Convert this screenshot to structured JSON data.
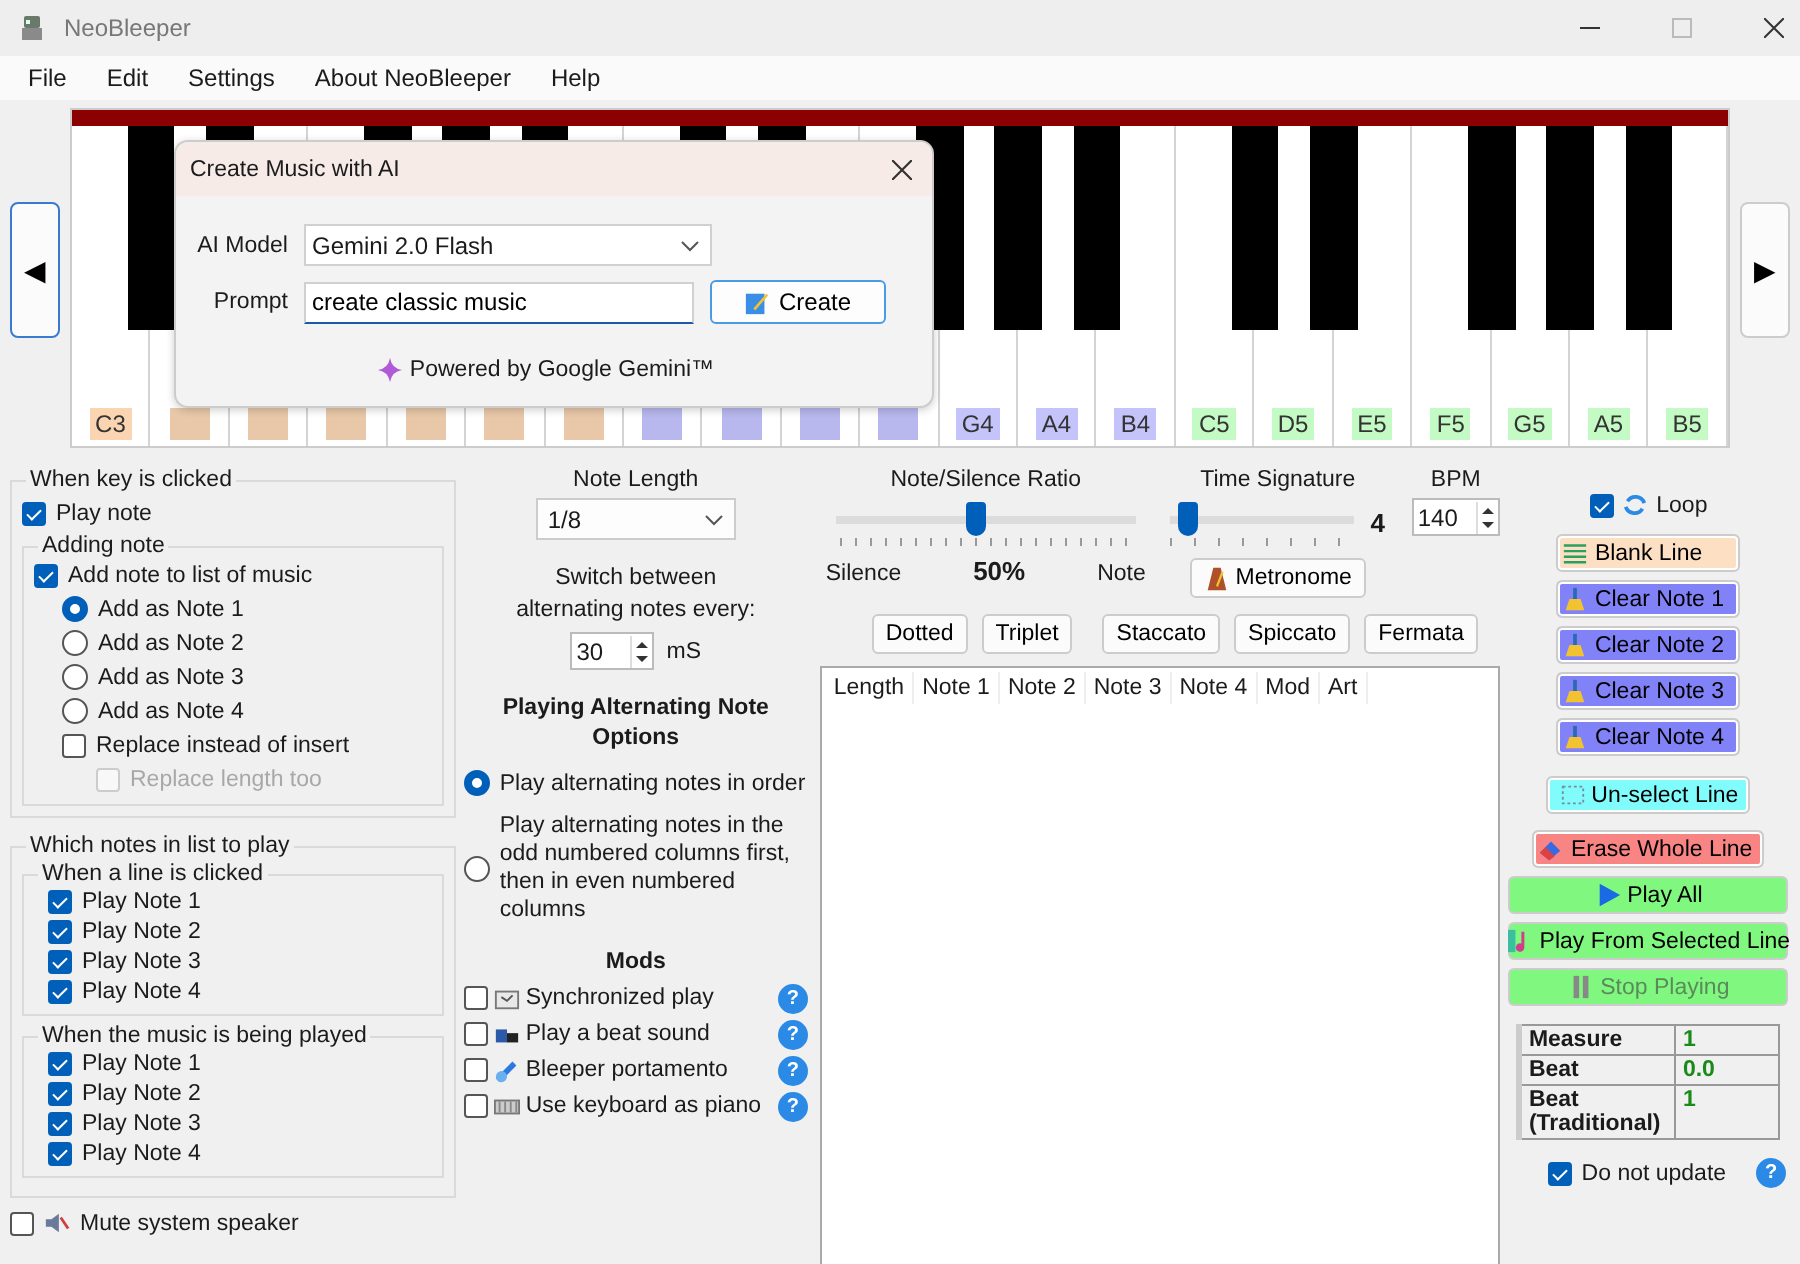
{
  "window": {
    "title": "NeoBleeper"
  },
  "menu": [
    "File",
    "Edit",
    "Settings",
    "About NeoBleeper",
    "Help"
  ],
  "keyboard": {
    "left": "◀",
    "right": "▶",
    "keys": [
      {
        "label": "C3",
        "color": "#fbd5b2",
        "sharp": true
      },
      {
        "color": "#e8c8a8",
        "sharp": true
      },
      {
        "color": "#e8c8a8",
        "sharp": false
      },
      {
        "color": "#e8c8a8",
        "sharp": true
      },
      {
        "color": "#e8c8a8",
        "sharp": true
      },
      {
        "color": "#e8c8a8",
        "sharp": true
      },
      {
        "color": "#e8c8a8",
        "sharp": false
      },
      {
        "color": "#b8b8ee",
        "sharp": true
      },
      {
        "color": "#b8b8ee",
        "sharp": true
      },
      {
        "color": "#b8b8ee",
        "sharp": false
      },
      {
        "color": "#b8b8ee",
        "sharp": true
      },
      {
        "label": "G4",
        "color": "#c4c4fa",
        "sharp": true
      },
      {
        "label": "A4",
        "color": "#c4c4fa",
        "sharp": true
      },
      {
        "label": "B4",
        "color": "#c4c4fa",
        "sharp": false
      },
      {
        "label": "C5",
        "color": "#c4fac4",
        "sharp": true
      },
      {
        "label": "D5",
        "color": "#c4fac4",
        "sharp": true
      },
      {
        "label": "E5",
        "color": "#c4fac4",
        "sharp": false
      },
      {
        "label": "F5",
        "color": "#c4fac4",
        "sharp": true
      },
      {
        "label": "G5",
        "color": "#c4fac4",
        "sharp": true
      },
      {
        "label": "A5",
        "color": "#c4fac4",
        "sharp": true
      },
      {
        "label": "B5",
        "color": "#c4fac4",
        "sharp": false
      }
    ]
  },
  "dialog": {
    "title": "Create Music with AI",
    "model_label": "AI Model",
    "model": "Gemini 2.0 Flash",
    "prompt_label": "Prompt",
    "prompt": "create classic music",
    "create_button": "Create",
    "footer": "Powered by Google Gemini™"
  },
  "key_clicked": {
    "title": "When key is clicked",
    "play_note": {
      "label": "Play note",
      "checked": true
    },
    "adding": {
      "title": "Adding note",
      "add_to_list": {
        "label": "Add note to list of music",
        "checked": true
      },
      "options": [
        {
          "label": "Add as Note 1",
          "selected": true
        },
        {
          "label": "Add as Note 2",
          "selected": false
        },
        {
          "label": "Add as Note 3",
          "selected": false
        },
        {
          "label": "Add as Note 4",
          "selected": false
        }
      ],
      "replace": {
        "label": "Replace instead of insert",
        "checked": false
      },
      "replace_length": {
        "label": "Replace length too",
        "checked": false,
        "disabled": true
      }
    }
  },
  "which_notes": {
    "title": "Which notes in list to play",
    "groups": [
      {
        "title": "When a line is clicked",
        "items": [
          {
            "label": "Play Note 1",
            "checked": true
          },
          {
            "label": "Play Note 2",
            "checked": true
          },
          {
            "label": "Play Note 3",
            "checked": true
          },
          {
            "label": "Play Note 4",
            "checked": true
          }
        ]
      },
      {
        "title": "When the music is being played",
        "items": [
          {
            "label": "Play Note 1",
            "checked": true
          },
          {
            "label": "Play Note 2",
            "checked": true
          },
          {
            "label": "Play Note 3",
            "checked": true
          },
          {
            "label": "Play Note 4",
            "checked": true
          }
        ]
      }
    ]
  },
  "mute": {
    "label": "Mute system speaker",
    "checked": false
  },
  "note_length": {
    "label": "Note Length",
    "value": "1/8"
  },
  "switch": {
    "label": "Switch between alternating notes every:",
    "value": "30",
    "unit": "mS"
  },
  "alternating": {
    "title": "Playing Alternating Note Options",
    "options": [
      {
        "label": "Play alternating notes in order",
        "selected": true
      },
      {
        "label": "Play alternating notes in the odd numbered columns first, then in even numbered columns",
        "selected": false
      }
    ]
  },
  "mods": {
    "title": "Mods",
    "items": [
      {
        "label": "Synchronized play",
        "checked": false,
        "kind": "sync",
        "help": "?"
      },
      {
        "label": "Play a beat sound",
        "checked": false,
        "kind": "beat",
        "help": "?"
      },
      {
        "label": "Bleeper portamento",
        "checked": false,
        "kind": "portamento",
        "help": "?"
      },
      {
        "label": "Use keyboard as piano",
        "checked": false,
        "kind": "keyboard",
        "help": "?"
      }
    ]
  },
  "ratio": {
    "title": "Note/Silence Ratio",
    "level": 0.47,
    "left": "Silence",
    "reading": "50%",
    "right": "Note"
  },
  "time_signature": {
    "title": "Time Signature",
    "level": 0.1,
    "value": "4",
    "metronome": "Metronome"
  },
  "bpm": {
    "label": "BPM",
    "value": "140"
  },
  "articulations": [
    "Dotted",
    "Triplet",
    "Staccato",
    "Spiccato",
    "Fermata"
  ],
  "table": {
    "columns": [
      "Length",
      "Note 1",
      "Note 2",
      "Note 3",
      "Note 4",
      "Mod",
      "Art"
    ]
  },
  "loop": {
    "label": "Loop",
    "checked": true
  },
  "line_buttons": [
    {
      "label": "Blank Line",
      "color": "#fde0c4",
      "kind": "lines"
    },
    {
      "label": "Clear Note 1",
      "color": "#8282f8",
      "kind": "broom"
    },
    {
      "label": "Clear Note 2",
      "color": "#8282f8",
      "kind": "broom"
    },
    {
      "label": "Clear Note 3",
      "color": "#8282f8",
      "kind": "broom"
    },
    {
      "label": "Clear Note 4",
      "color": "#8282f8",
      "kind": "broom"
    },
    {
      "label": "Un-select Line",
      "color": "#80fcfc",
      "kind": "select"
    },
    {
      "label": "Erase Whole Line",
      "color": "#f88484",
      "kind": "eraser"
    }
  ],
  "play_buttons": [
    {
      "label": "Play All",
      "kind": "play",
      "disabled": false
    },
    {
      "label": "Play From Selected Line",
      "kind": "note",
      "disabled": false
    },
    {
      "label": "Stop Playing",
      "kind": "pause",
      "disabled": true
    }
  ],
  "status": [
    {
      "label": "Measure",
      "value": "1"
    },
    {
      "label": "Beat",
      "value": "0.0"
    },
    {
      "label": "Beat (Traditional)",
      "value": "1"
    }
  ],
  "do_not_update": {
    "label": "Do not update",
    "checked": true,
    "help": "?"
  }
}
